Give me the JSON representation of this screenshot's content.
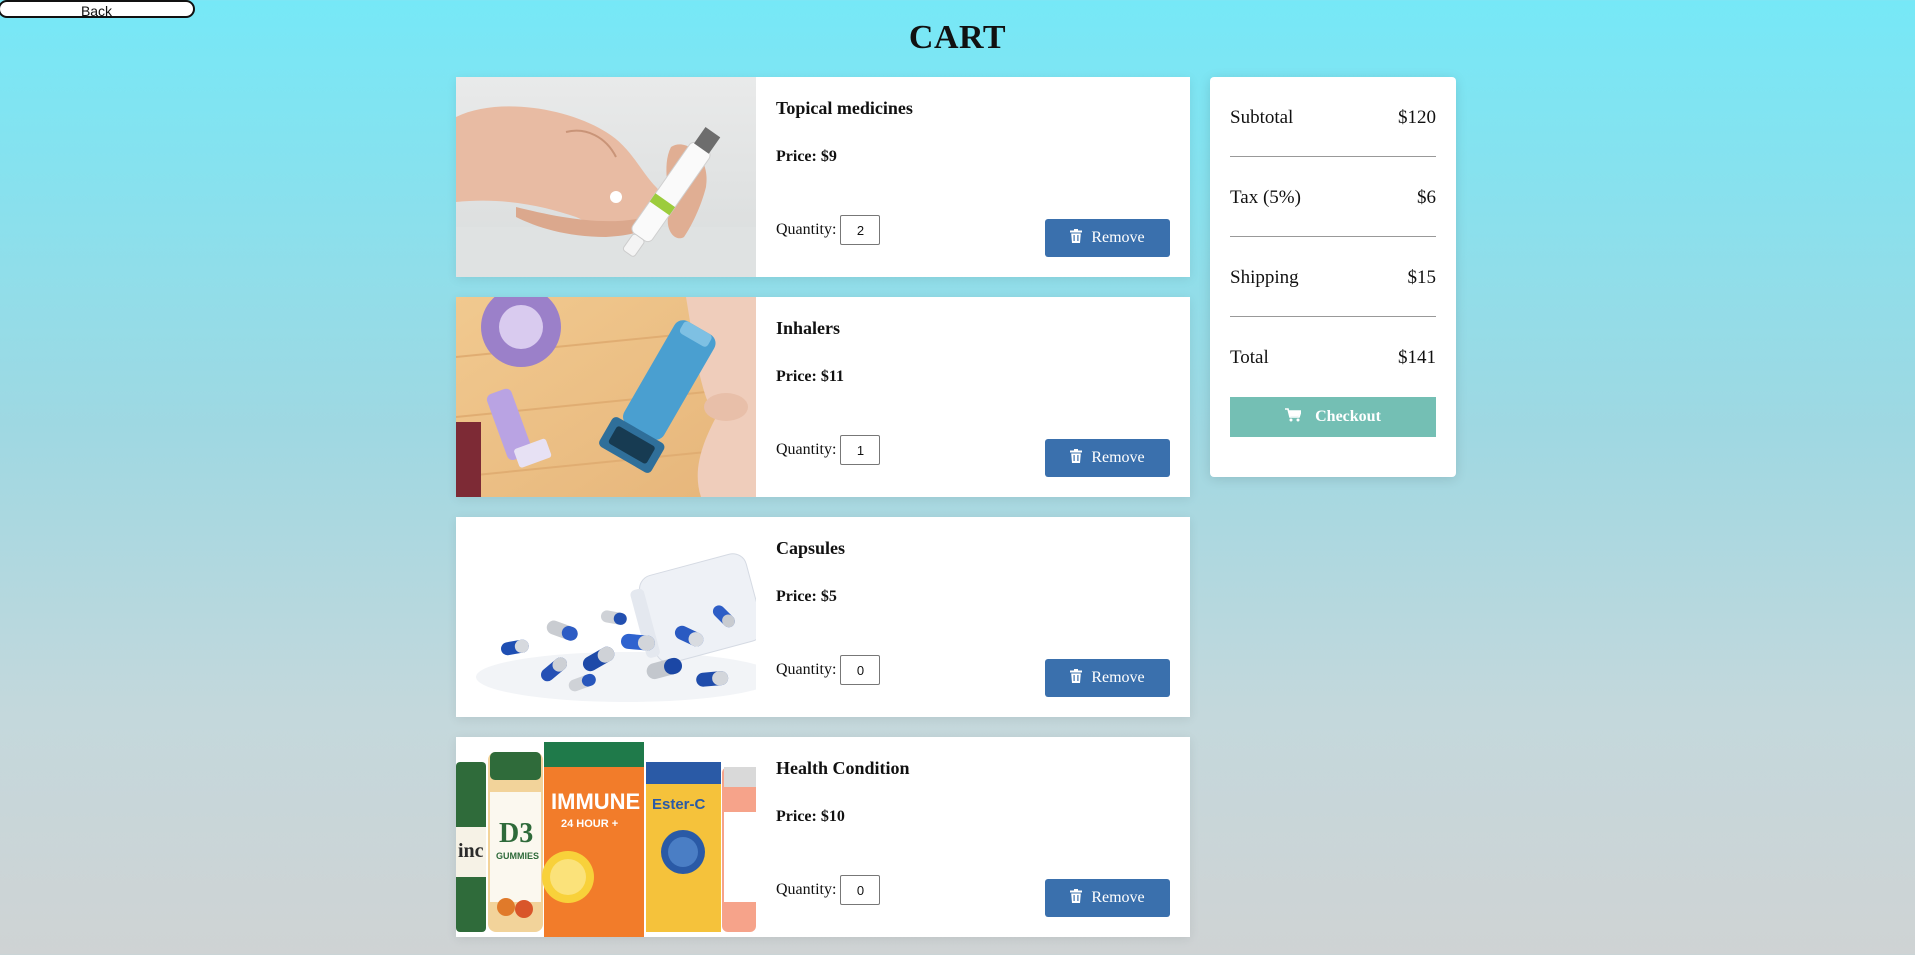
{
  "nav": {
    "back_label": "Back"
  },
  "page": {
    "title": "CART"
  },
  "labels": {
    "quantity": "Quantity:",
    "remove": "Remove"
  },
  "cart": {
    "items": [
      {
        "name": "Topical medicines",
        "price": "Price: $9",
        "quantity": "2",
        "image_icon": "ointment-tube-image"
      },
      {
        "name": "Inhalers",
        "price": "Price: $11",
        "quantity": "1",
        "image_icon": "inhaler-image"
      },
      {
        "name": "Capsules",
        "price": "Price: $5",
        "quantity": "0",
        "image_icon": "capsules-image"
      },
      {
        "name": "Health Condition",
        "price": "Price: $10",
        "quantity": "0",
        "image_icon": "supplement-bottles-image"
      }
    ]
  },
  "summary": {
    "subtotal_label": "Subtotal",
    "subtotal_value": "$120",
    "tax_label": "Tax (5%)",
    "tax_value": "$6",
    "shipping_label": "Shipping",
    "shipping_value": "$15",
    "total_label": "Total",
    "total_value": "$141",
    "checkout_label": "Checkout"
  },
  "images": {
    "bottle_labels": {
      "immune": "IMMUNE",
      "immune_sub": "24 HOUR +",
      "ester": "Ester-C",
      "d3": "D3",
      "d3_sub": "GUMMIES",
      "zinc": "inc"
    }
  },
  "colors": {
    "remove_button": "#3a70ad",
    "checkout_button": "#74bfb4",
    "background_top": "#76e8f7",
    "background_bottom": "#cfd3d4"
  }
}
